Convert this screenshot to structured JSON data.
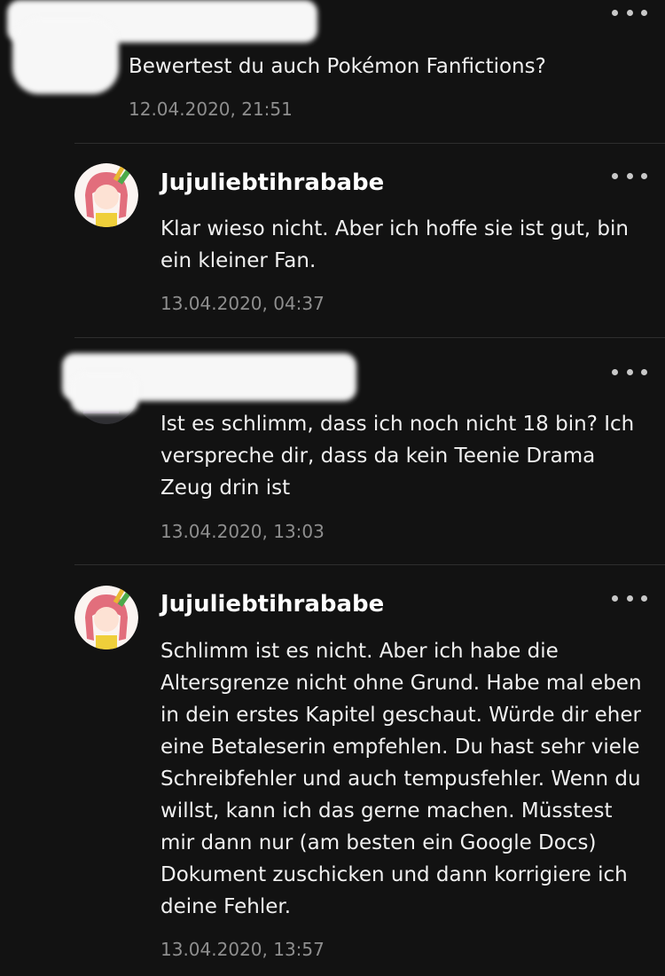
{
  "comments": [
    {
      "username": "",
      "text": "Bewertest du auch Pokémon Fanfictions?",
      "timestamp": "12.04.2020, 21:51",
      "more_icon": "more-horizontal-icon"
    },
    {
      "username": "Jujuliebtihrababe",
      "text": "Klar wieso nicht. Aber ich hoffe sie ist gut, bin ein kleiner Fan.",
      "timestamp": "13.04.2020, 04:37",
      "more_icon": "more-horizontal-icon"
    },
    {
      "username": "",
      "text": "Ist es schlimm, dass ich noch nicht 18 bin? Ich verspreche dir, dass da kein Teenie Drama Zeug drin ist",
      "timestamp": "13.04.2020, 13:03",
      "more_icon": "more-horizontal-icon"
    },
    {
      "username": "Jujuliebtihrababe",
      "text": "Schlimm ist es nicht. Aber ich habe die Altersgrenze nicht ohne Grund. Habe mal eben in dein erstes Kapitel geschaut. Würde dir eher eine Betaleserin empfehlen. Du hast sehr viele Schreibfehler und auch tempusfehler. Wenn du willst, kann ich das gerne machen. Müsstest mir dann nur (am besten ein Google Docs) Dokument zuschicken und dann korrigiere ich deine Fehler.",
      "timestamp": "13.04.2020, 13:57",
      "more_icon": "more-horizontal-icon"
    }
  ],
  "colors": {
    "background": "#121212",
    "text": "#f0f0f0",
    "timestamp": "#8e8e8e",
    "divider": "#2e2e2e"
  }
}
